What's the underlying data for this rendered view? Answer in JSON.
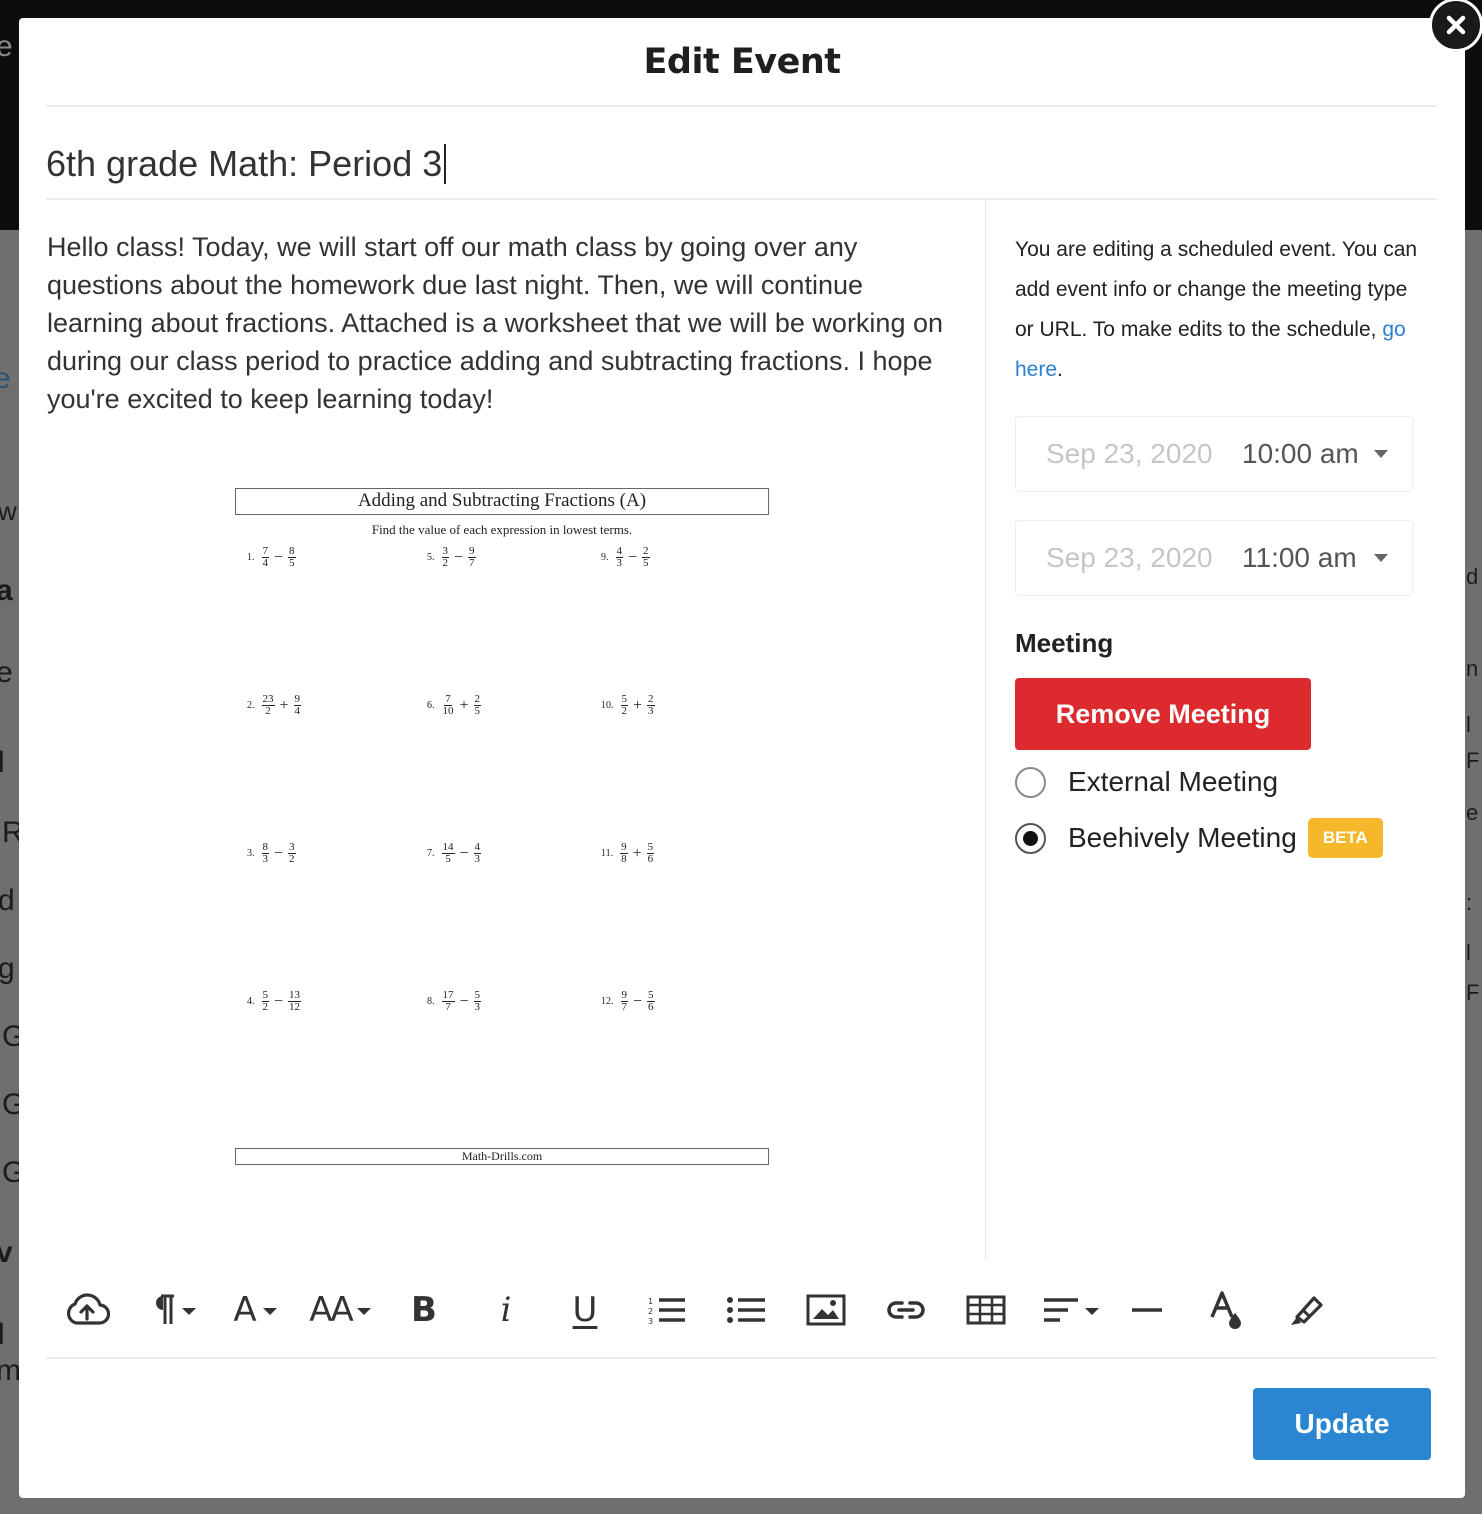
{
  "modal": {
    "title": "Edit Event",
    "close_icon": "close-icon"
  },
  "event": {
    "name": "6th grade Math: Period 3",
    "description": "Hello class! Today, we will start off our math class by going over any questions about the homework due last night. Then, we will continue learning about fractions. Attached is a worksheet that we will be working on during our class period to practice adding and subtracting fractions. I hope you're excited to keep learning today!"
  },
  "worksheet": {
    "title": "Adding and Subtracting Fractions (A)",
    "subtitle": "Find the value of each expression in lowest terms.",
    "footer": "Math-Drills.com",
    "problems": [
      {
        "num": "1.",
        "a": [
          "7",
          "4"
        ],
        "op": "−",
        "b": [
          "8",
          "5"
        ]
      },
      {
        "num": "5.",
        "a": [
          "3",
          "2"
        ],
        "op": "−",
        "b": [
          "9",
          "7"
        ]
      },
      {
        "num": "9.",
        "a": [
          "4",
          "3"
        ],
        "op": "−",
        "b": [
          "2",
          "5"
        ]
      },
      {
        "num": "2.",
        "a": [
          "23",
          "2"
        ],
        "op": "+",
        "b": [
          "9",
          "4"
        ]
      },
      {
        "num": "6.",
        "a": [
          "7",
          "10"
        ],
        "op": "+",
        "b": [
          "2",
          "5"
        ]
      },
      {
        "num": "10.",
        "a": [
          "5",
          "2"
        ],
        "op": "+",
        "b": [
          "2",
          "3"
        ]
      },
      {
        "num": "3.",
        "a": [
          "8",
          "3"
        ],
        "op": "−",
        "b": [
          "3",
          "2"
        ]
      },
      {
        "num": "7.",
        "a": [
          "14",
          "5"
        ],
        "op": "−",
        "b": [
          "4",
          "3"
        ]
      },
      {
        "num": "11.",
        "a": [
          "9",
          "8"
        ],
        "op": "+",
        "b": [
          "5",
          "6"
        ]
      },
      {
        "num": "4.",
        "a": [
          "5",
          "2"
        ],
        "op": "−",
        "b": [
          "13",
          "12"
        ]
      },
      {
        "num": "8.",
        "a": [
          "17",
          "7"
        ],
        "op": "−",
        "b": [
          "5",
          "3"
        ]
      },
      {
        "num": "12.",
        "a": [
          "9",
          "7"
        ],
        "op": "−",
        "b": [
          "5",
          "6"
        ]
      }
    ]
  },
  "sidebar": {
    "info_prefix": "You are editing a scheduled event. You can add event info or change the meeting type or URL. To make edits to the schedule, ",
    "info_link": "go here",
    "info_suffix": ".",
    "start": {
      "date": "Sep 23, 2020",
      "time": "10:00 am"
    },
    "end": {
      "date": "Sep 23, 2020",
      "time": "11:00 am"
    },
    "meeting_label": "Meeting",
    "remove_meeting": "Remove Meeting",
    "options": [
      {
        "label": "External Meeting",
        "checked": false
      },
      {
        "label": "Beehively Meeting",
        "checked": true,
        "badge": "BETA"
      }
    ]
  },
  "toolbar": {
    "font_letter": "A",
    "size_letters": "AA",
    "bold": "B",
    "italic": "i",
    "underline": "U",
    "icons": [
      "upload-cloud-icon",
      "paragraph-icon",
      "font-family-icon",
      "font-size-icon",
      "bold-icon",
      "italic-icon",
      "underline-icon",
      "ordered-list-icon",
      "unordered-list-icon",
      "image-icon",
      "link-icon",
      "table-icon",
      "align-icon",
      "horizontal-rule-icon",
      "text-color-icon",
      "highlight-icon"
    ]
  },
  "footer": {
    "update": "Update"
  },
  "colors": {
    "remove": "#dc2a2f",
    "update": "#2b86d2",
    "beta": "#f5b82a",
    "link": "#2a7fd4"
  }
}
